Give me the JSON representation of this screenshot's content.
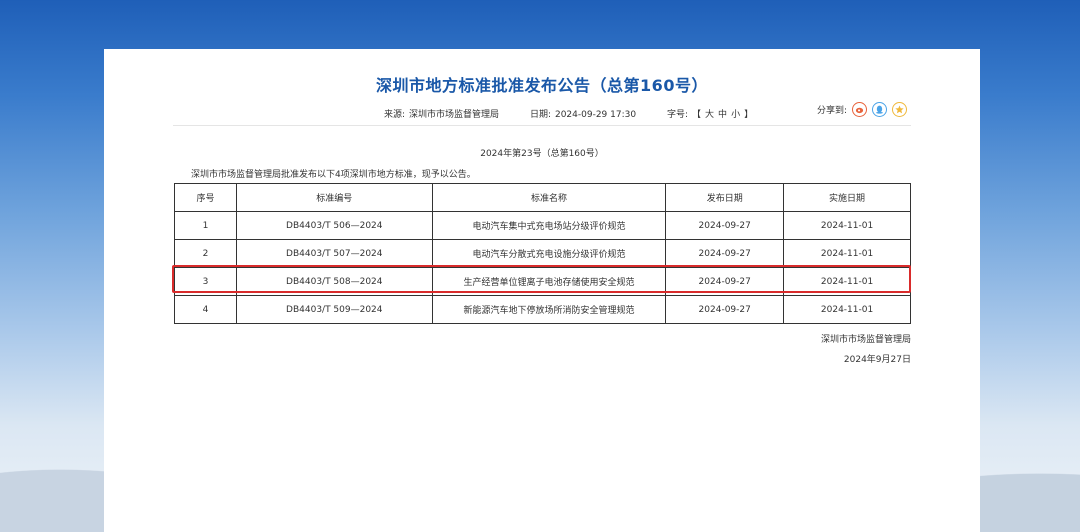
{
  "notice": {
    "title": "深圳市地方标准批准发布公告（总第160号）",
    "source_label": "来源:",
    "source_value": "深圳市市场监督管理局",
    "date_label": "日期:",
    "date_value": "2024-09-29 17:30",
    "font_label": "字号:",
    "font_sizes": [
      "【",
      "大",
      "中",
      "小",
      "】"
    ],
    "share_label": "分享到:",
    "share_icons": [
      "weibo-icon",
      "qq-icon",
      "favorite-icon"
    ],
    "subtitle": "2024年第23号（总第160号）",
    "intro": "深圳市市场监督管理局批准发布以下4项深圳市地方标准，现予以公告。",
    "signature_org": "深圳市市场监督管理局",
    "signature_date": "2024年9月27日"
  },
  "table": {
    "headers": [
      "序号",
      "标准编号",
      "标准名称",
      "发布日期",
      "实施日期"
    ],
    "rows": [
      [
        "1",
        "DB4403/T 506—2024",
        "电动汽车集中式充电场站分级评价规范",
        "2024-09-27",
        "2024-11-01"
      ],
      [
        "2",
        "DB4403/T 507—2024",
        "电动汽车分散式充电设施分级评价规范",
        "2024-09-27",
        "2024-11-01"
      ],
      [
        "3",
        "DB4403/T 508—2024",
        "生产经营单位锂离子电池存储使用安全规范",
        "2024-09-27",
        "2024-11-01"
      ],
      [
        "4",
        "DB4403/T 509—2024",
        "新能源汽车地下停放场所消防安全管理规范",
        "2024-09-27",
        "2024-11-01"
      ]
    ]
  },
  "colors": {
    "title": "#1a58a8",
    "highlight_border": "#d92b2b"
  }
}
